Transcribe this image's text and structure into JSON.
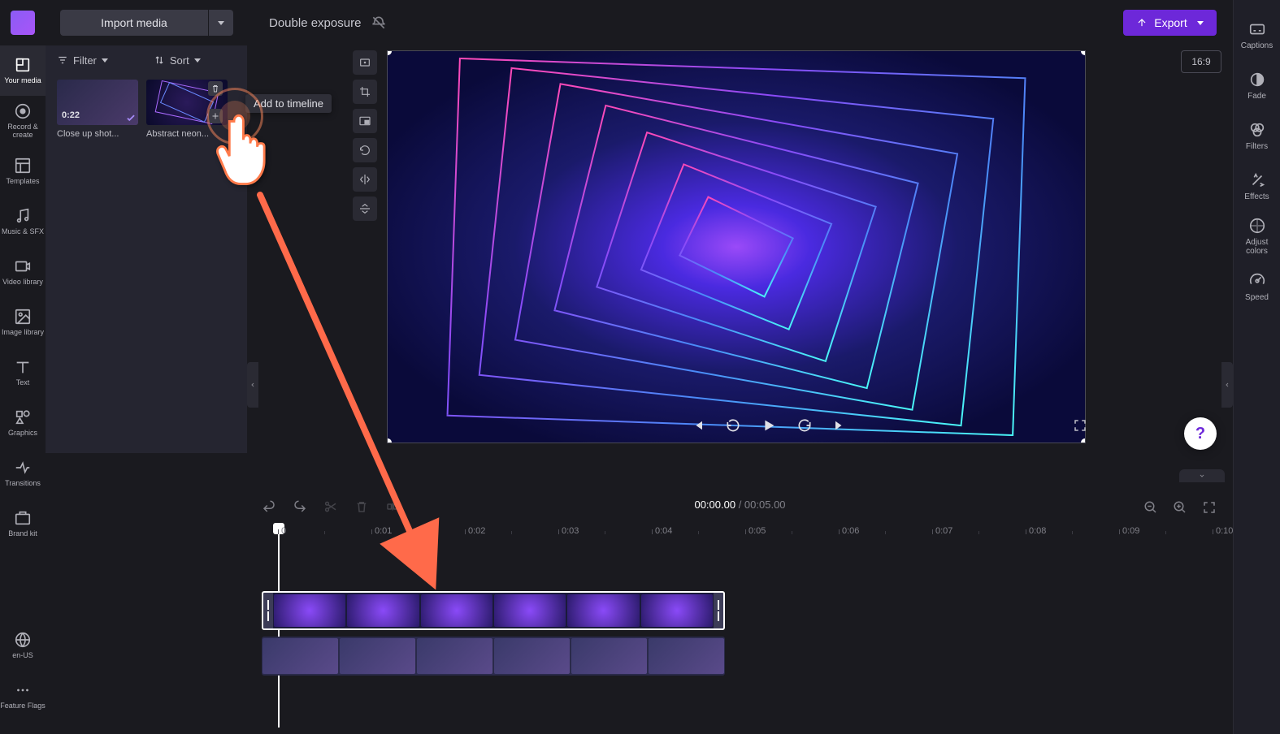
{
  "topbar": {
    "import_label": "Import media",
    "project_title": "Double exposure",
    "export_label": "Export"
  },
  "aspect_ratio": "16:9",
  "sidebar_left": [
    {
      "id": "your-media",
      "label": "Your media"
    },
    {
      "id": "record-create",
      "label": "Record & create"
    },
    {
      "id": "templates",
      "label": "Templates"
    },
    {
      "id": "music-sfx",
      "label": "Music & SFX"
    },
    {
      "id": "video-library",
      "label": "Video library"
    },
    {
      "id": "image-library",
      "label": "Image library"
    },
    {
      "id": "text",
      "label": "Text"
    },
    {
      "id": "graphics",
      "label": "Graphics"
    },
    {
      "id": "transitions",
      "label": "Transitions"
    },
    {
      "id": "brand-kit",
      "label": "Brand kit"
    }
  ],
  "sidebar_left_bottom": [
    {
      "id": "en-us",
      "label": "en-US"
    },
    {
      "id": "feature-flags",
      "label": "Feature Flags"
    }
  ],
  "sidebar_right": [
    {
      "id": "captions",
      "label": "Captions"
    },
    {
      "id": "fade",
      "label": "Fade"
    },
    {
      "id": "filters",
      "label": "Filters"
    },
    {
      "id": "effects",
      "label": "Effects"
    },
    {
      "id": "adjust-colors",
      "label": "Adjust colors"
    },
    {
      "id": "speed",
      "label": "Speed"
    }
  ],
  "media_panel": {
    "filter_label": "Filter",
    "sort_label": "Sort",
    "items": [
      {
        "duration": "0:22",
        "label": "Close up shot...",
        "added": true
      },
      {
        "duration": "",
        "label": "Abstract neon..."
      }
    ]
  },
  "tooltip": "Add to timeline",
  "timecode": {
    "current": "00:00.00",
    "sep": " / ",
    "total": "00:05.00"
  },
  "ruler": [
    "0",
    "0:01",
    "0:02",
    "0:03",
    "0:04",
    "0:05",
    "0:06",
    "0:07",
    "0:08",
    "0:09",
    "0:10"
  ]
}
